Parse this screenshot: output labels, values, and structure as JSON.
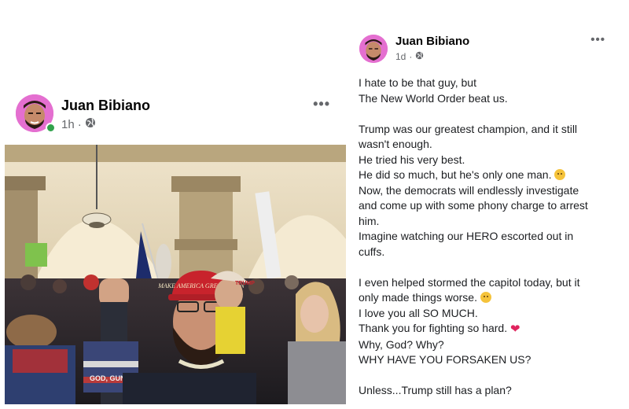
{
  "left_post": {
    "author": "Juan Bibiano",
    "time": "1h",
    "separator": "·",
    "more": "•••",
    "photo_sign": "TRUMP",
    "hat_text": "MAKE AMERICA GREAT AGAIN",
    "shirt_text": "GOD, GUNS & TRUMP"
  },
  "right_post": {
    "author": "Juan Bibiano",
    "time": "1d",
    "separator": "·",
    "more": "•••",
    "lines": [
      "I hate to be that guy, but",
      "The New World Order beat us.",
      "",
      "Trump was our greatest champion, and it still",
      "wasn't enough.",
      "He tried his very best.",
      "He did so much, but he's only one man.",
      "Now, the democrats will endlessly investigate",
      "and come up with some phony charge to arrest",
      "him.",
      "Imagine watching our HERO escorted out in",
      "cuffs.",
      "",
      "I even helped stormed the capitol today, but it",
      "only made things worse.",
      "I love you all SO MUCH.",
      "Thank you for fighting so hard.",
      "Why, God? Why?",
      "WHY HAVE YOU FORSAKEN US?",
      "",
      "Unless...Trump still has a plan?"
    ]
  },
  "colors": {
    "name": "#050505",
    "meta": "#65676b",
    "online": "#31a24c",
    "avatar_bg": "#e46fd0"
  }
}
